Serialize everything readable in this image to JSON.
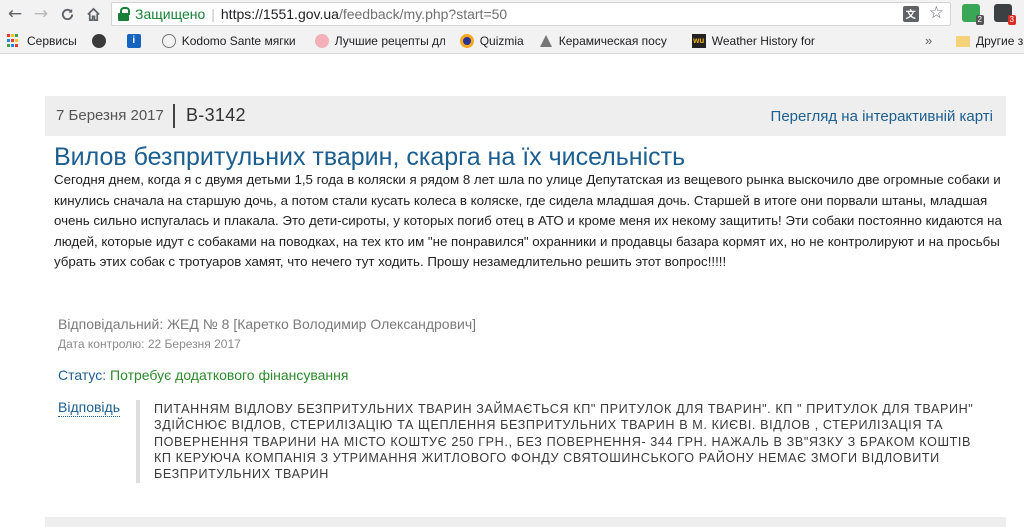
{
  "browser": {
    "security_label": "Защищено",
    "url_host": "https://1551.gov.ua",
    "url_path": "/feedback/my.php?start=50",
    "extension_badges": [
      "2",
      "3"
    ]
  },
  "bookmarks": {
    "items": [
      {
        "label": "Сервисы",
        "icon": "apps-grid-icon"
      },
      {
        "label": "",
        "icon": "dark-circle-favicon"
      },
      {
        "label": "",
        "icon": "info-favicon"
      },
      {
        "label": "Kodomo Sante мягки",
        "icon": "globe-favicon"
      },
      {
        "label": "Лучшие рецепты дл",
        "icon": "recipe-favicon"
      },
      {
        "label": "Quizmia",
        "icon": "quizmia-favicon"
      },
      {
        "label": "Керамическая посу",
        "icon": "ceramic-favicon"
      },
      {
        "label": "Weather History for",
        "icon": "wu-favicon"
      }
    ],
    "more": "»",
    "other_label": "Другие з"
  },
  "appeal": {
    "date": "7 Березня 2017",
    "id": "В-3142",
    "map_link": "Перегляд на інтерактивній карті",
    "title": "Вилов безпритульних тварин, скарга на їх чисельність",
    "text": "Сегодня днем, когда я с двумя детьми 1,5 года в коляски я рядом 8 лет шла по улице Депутатская из вещевого рынка выскочило две огромные собаки и кинулись сначала на старшую дочь, а потом стали кусать колеса в коляске, где сидела младшая дочь. Старшей в итоге они порвали штаны, младшая очень сильно испугалась и плакала. Это дети-сироты, у которых погиб отец в АТО и кроме меня их некому защитить! Эти собаки постоянно кидаются на людей, которые идут с собаками на поводках, на тех кто им \"не понравился\" охранники и продавцы базара кормят их, но не контролируют и на просьбы убрать этих собак с тротуаров хамят, что нечего тут ходить. Прошу незамедлительно решить этот вопрос!!!!!",
    "responsible": "Відповідальний: ЖЕД № 8 [Каретко Володимир Олександрович]",
    "control_date": "Дата контролю: 22 Березня 2017",
    "status_label": "Статус:",
    "status_value": "Потребує додаткового фінансування",
    "answer_label": "Відповідь",
    "answer_text": "ПИТАННЯМ ВІДЛОВУ БЕЗПРИТУЛЬНИХ ТВАРИН ЗАЙМАЄТЬСЯ КП\" ПРИТУЛОК ДЛЯ ТВАРИН\". КП \" ПРИТУЛОК ДЛЯ ТВАРИН\" ЗДІЙСНЮЄ ВІДЛОВ, СТЕРИЛІЗАЦІЮ ТА ЩЕПЛЕННЯ БЕЗПРИТУЛЬНИХ ТВАРИН В М. КИЄВІ. ВІДЛОВ , СТЕРИЛІЗАЦІЯ ТА ПОВЕРНЕННЯ ТВАРИНИ НА МІСТО КОШТУЄ 250 ГРН., БЕЗ ПОВЕРНЕННЯ- 344 ГРН. НАЖАЛЬ В ЗВ\"ЯЗКУ З БРАКОМ КОШТІВ КП КЕРУЮЧА КОМПАНІЯ З УТРИМАННЯ ЖИТЛОВОГО ФОНДУ СВЯТОШИНСЬКОГО РАЙОНУ НЕМАЄ ЗМОГИ ВІДЛОВИТИ БЕЗПРИТУЛЬНИХ ТВАРИН"
  },
  "colors": {
    "link_blue": "#1b5e8f",
    "status_green": "#2b8a2b",
    "secure_green": "#188038",
    "header_bg": "#eeeeee"
  }
}
